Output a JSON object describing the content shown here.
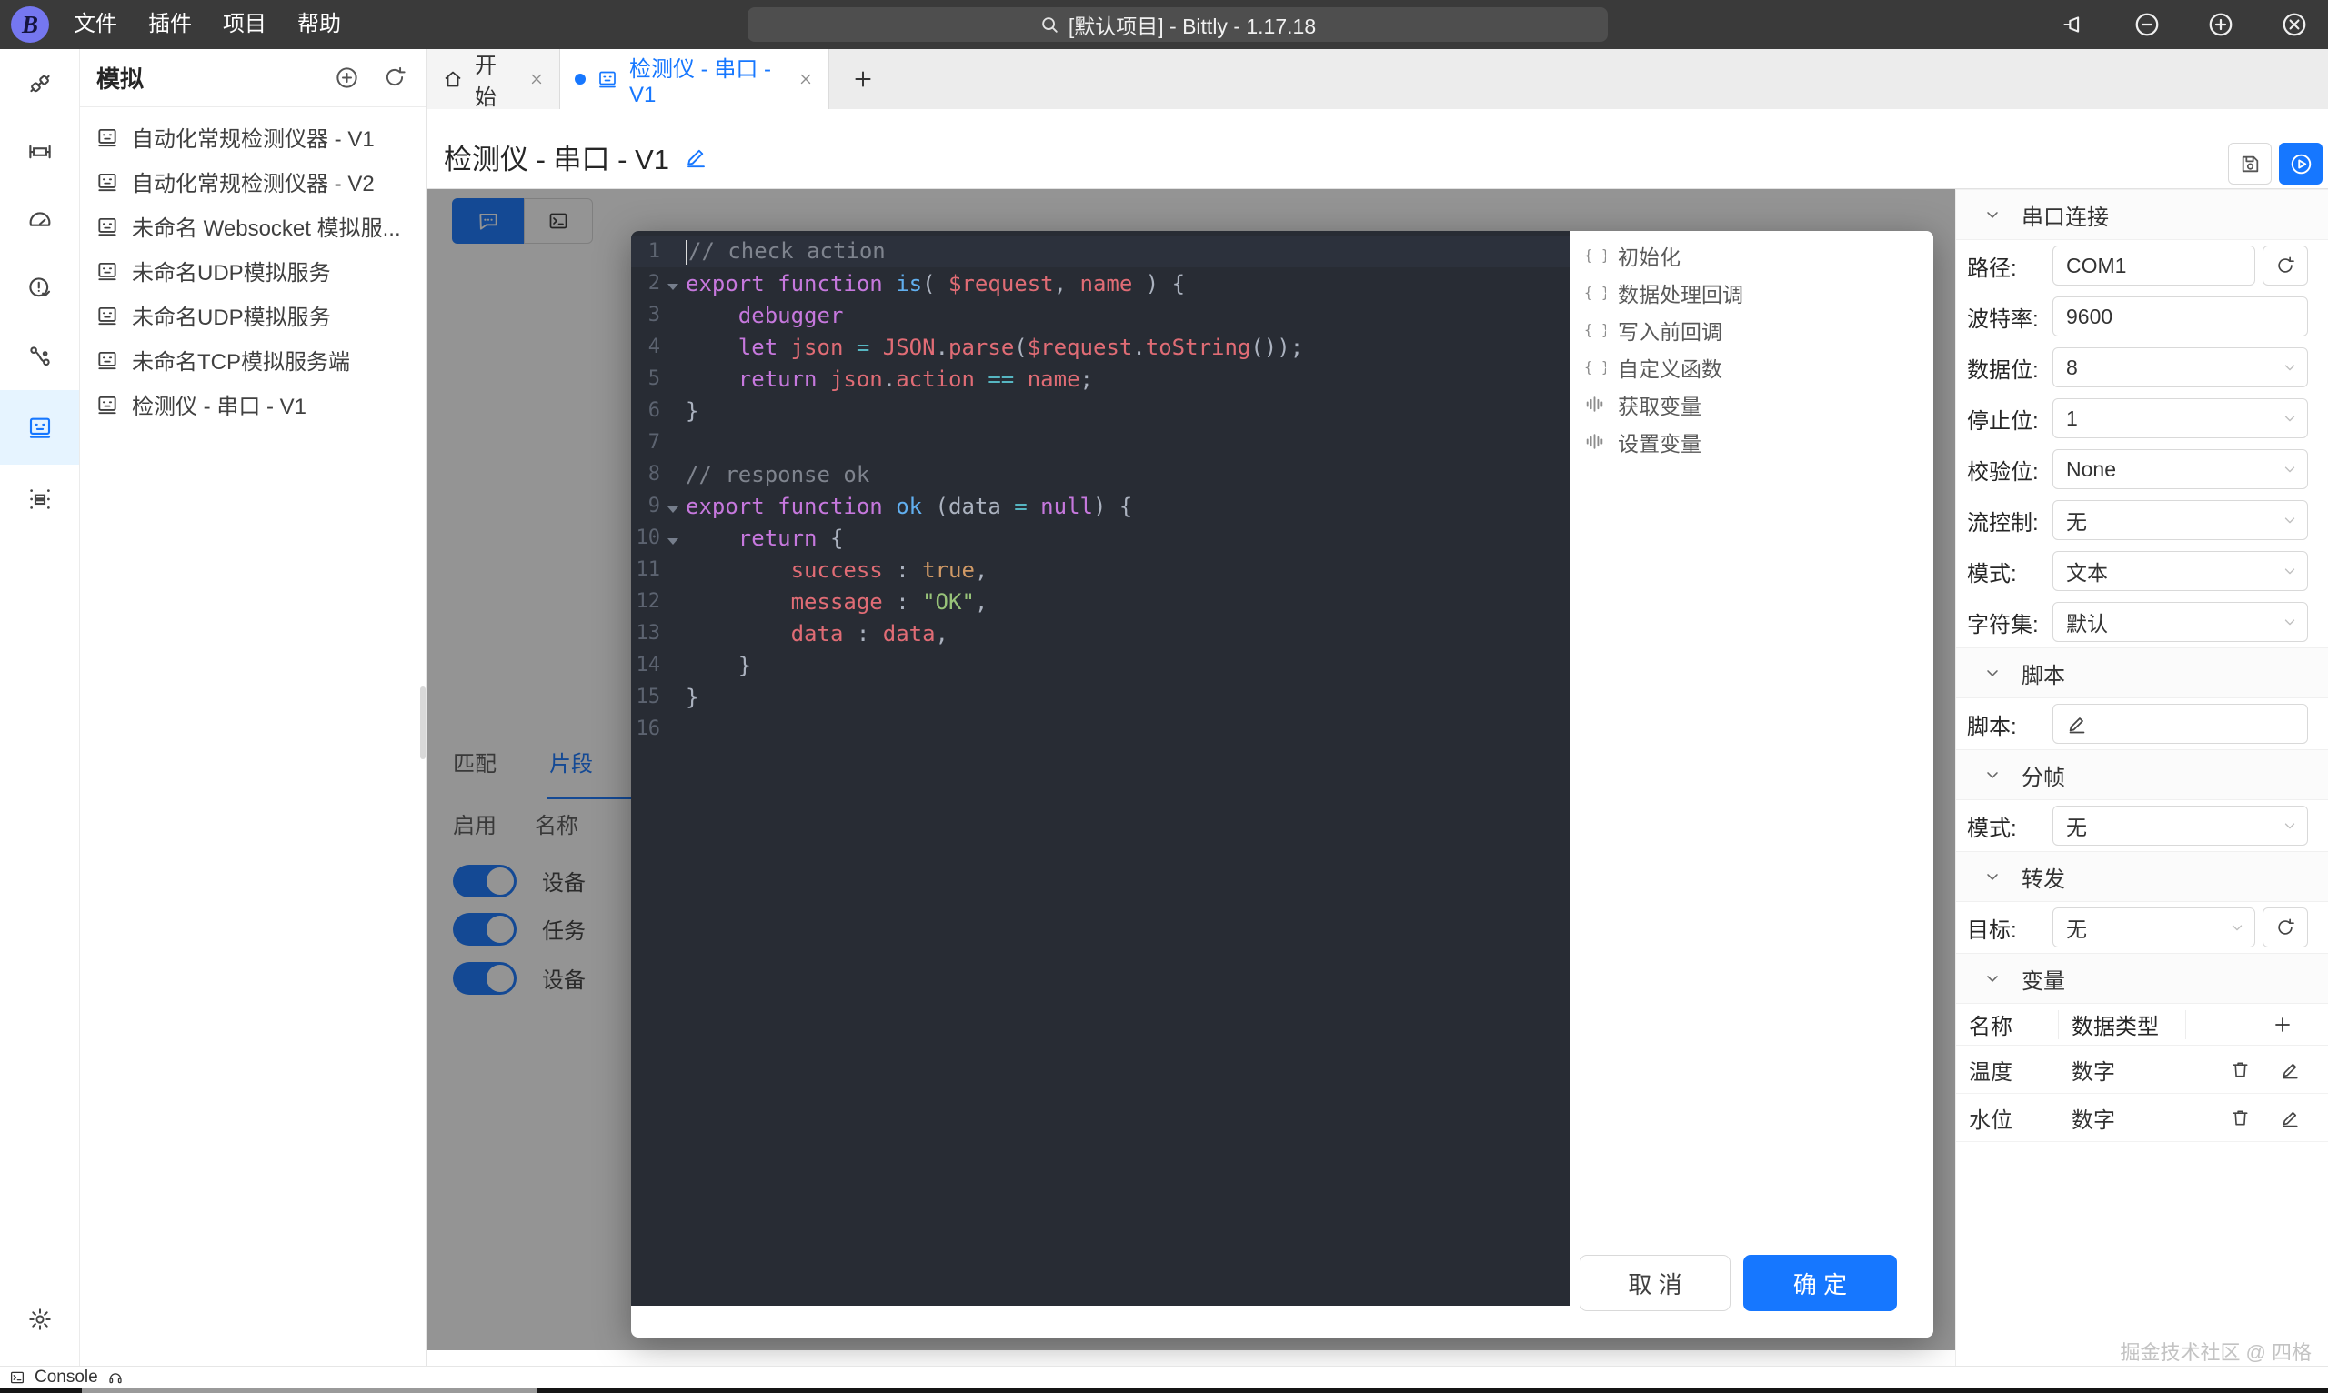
{
  "titlebar": {
    "logo_letter": "B",
    "menus": [
      {
        "label": "文件"
      },
      {
        "label": "插件"
      },
      {
        "label": "项目"
      },
      {
        "label": "帮助"
      }
    ],
    "search_text": "[默认项目] - Bittly - 1.17.18"
  },
  "sidebar": {
    "title": "模拟",
    "items": [
      {
        "label": "自动化常规检测仪器 - V1"
      },
      {
        "label": "自动化常规检测仪器 - V2"
      },
      {
        "label": "未命名 Websocket 模拟服..."
      },
      {
        "label": "未命名UDP模拟服务"
      },
      {
        "label": "未命名UDP模拟服务"
      },
      {
        "label": "未命名TCP模拟服务端"
      },
      {
        "label": "检测仪 - 串口 - V1"
      }
    ]
  },
  "tabs": {
    "start": "开始",
    "active": "检测仪 - 串口 - V1"
  },
  "page": {
    "title": "检测仪 - 串口 - V1"
  },
  "underlay": {
    "tab_match": "匹配",
    "tab_fragment": "片段",
    "col_enable": "启用",
    "col_name": "名称",
    "rows": [
      {
        "label": "设备"
      },
      {
        "label": "任务"
      },
      {
        "label": "设备"
      }
    ]
  },
  "editor": {
    "lines": [
      {
        "num": 1,
        "active": true,
        "cursor": true,
        "tokens": [
          [
            "com",
            "// check action"
          ]
        ]
      },
      {
        "num": 2,
        "fold": true,
        "tokens": [
          [
            "kw",
            "export"
          ],
          [
            "pl",
            " "
          ],
          [
            "kw",
            "function"
          ],
          [
            "pl",
            " "
          ],
          [
            "fn",
            "is"
          ],
          [
            "pl",
            "( "
          ],
          [
            "vr",
            "$request"
          ],
          [
            "pl",
            ", "
          ],
          [
            "vr",
            "name"
          ],
          [
            "pl",
            " ) {"
          ]
        ]
      },
      {
        "num": 3,
        "tokens": [
          [
            "pl",
            "    "
          ],
          [
            "kw",
            "debugger"
          ]
        ]
      },
      {
        "num": 4,
        "tokens": [
          [
            "pl",
            "    "
          ],
          [
            "kw",
            "let"
          ],
          [
            "pl",
            " "
          ],
          [
            "vr",
            "json"
          ],
          [
            "pl",
            " "
          ],
          [
            "op",
            "="
          ],
          [
            "pl",
            " "
          ],
          [
            "vr",
            "JSON"
          ],
          [
            "pl",
            "."
          ],
          [
            "vr",
            "parse"
          ],
          [
            "pl",
            "("
          ],
          [
            "vr",
            "$request"
          ],
          [
            "pl",
            "."
          ],
          [
            "vr",
            "toString"
          ],
          [
            "pl",
            "());"
          ]
        ]
      },
      {
        "num": 5,
        "tokens": [
          [
            "pl",
            "    "
          ],
          [
            "kw",
            "return"
          ],
          [
            "pl",
            " "
          ],
          [
            "vr",
            "json"
          ],
          [
            "pl",
            "."
          ],
          [
            "vr",
            "action"
          ],
          [
            "pl",
            " "
          ],
          [
            "op",
            "=="
          ],
          [
            "pl",
            " "
          ],
          [
            "vr",
            "name"
          ],
          [
            "pl",
            ";"
          ]
        ]
      },
      {
        "num": 6,
        "tokens": [
          [
            "pl",
            "}"
          ]
        ]
      },
      {
        "num": 7,
        "tokens": []
      },
      {
        "num": 8,
        "tokens": [
          [
            "com",
            "// response ok"
          ]
        ]
      },
      {
        "num": 9,
        "fold": true,
        "tokens": [
          [
            "kw",
            "export"
          ],
          [
            "pl",
            " "
          ],
          [
            "kw",
            "function"
          ],
          [
            "pl",
            " "
          ],
          [
            "fn",
            "ok"
          ],
          [
            "pl",
            " ("
          ],
          [
            "pl",
            "data"
          ],
          [
            "pl",
            " "
          ],
          [
            "op",
            "="
          ],
          [
            "pl",
            " "
          ],
          [
            "kw",
            "null"
          ],
          [
            "pl",
            ") {"
          ]
        ]
      },
      {
        "num": 10,
        "fold": true,
        "tokens": [
          [
            "pl",
            "    "
          ],
          [
            "kw",
            "return"
          ],
          [
            "pl",
            " {"
          ]
        ]
      },
      {
        "num": 11,
        "tokens": [
          [
            "pl",
            "        "
          ],
          [
            "vr",
            "success"
          ],
          [
            "pl",
            " : "
          ],
          [
            "num",
            "true"
          ],
          [
            "pl",
            ","
          ]
        ]
      },
      {
        "num": 12,
        "tokens": [
          [
            "pl",
            "        "
          ],
          [
            "vr",
            "message"
          ],
          [
            "pl",
            " : "
          ],
          [
            "str",
            "\"OK\""
          ],
          [
            "pl",
            ","
          ]
        ]
      },
      {
        "num": 13,
        "tokens": [
          [
            "pl",
            "        "
          ],
          [
            "vr",
            "data"
          ],
          [
            "pl",
            " : "
          ],
          [
            "vr",
            "data"
          ],
          [
            "pl",
            ","
          ]
        ]
      },
      {
        "num": 14,
        "tokens": [
          [
            "pl",
            "    }"
          ]
        ]
      },
      {
        "num": 15,
        "tokens": [
          [
            "pl",
            "}"
          ]
        ]
      },
      {
        "num": 16,
        "tokens": []
      }
    ]
  },
  "events": [
    {
      "icon": "braces-icon",
      "label": "初始化"
    },
    {
      "icon": "braces-icon",
      "label": "数据处理回调"
    },
    {
      "icon": "braces-icon",
      "label": "写入前回调"
    },
    {
      "icon": "braces-icon",
      "label": "自定义函数"
    },
    {
      "icon": "variable-icon",
      "label": "获取变量"
    },
    {
      "icon": "variable-icon",
      "label": "设置变量"
    }
  ],
  "dialog": {
    "cancel_label": "取 消",
    "ok_label": "确 定"
  },
  "panel": {
    "serial": {
      "title": "串口连接",
      "fields": [
        {
          "label": "路径:",
          "value": "COM1"
        },
        {
          "label": "波特率:",
          "value": "9600"
        },
        {
          "label": "数据位:",
          "value": "8"
        },
        {
          "label": "停止位:",
          "value": "1"
        },
        {
          "label": "校验位:",
          "value": "None"
        },
        {
          "label": "流控制:",
          "value": "无"
        },
        {
          "label": "模式:",
          "value": "文本"
        },
        {
          "label": "字符集:",
          "value": "默认"
        }
      ]
    },
    "script": {
      "title": "脚本",
      "label": "脚本:"
    },
    "framing": {
      "title": "分帧",
      "label": "模式:",
      "value": "无"
    },
    "forward": {
      "title": "转发",
      "label": "目标:",
      "value": "无"
    },
    "variables": {
      "title": "变量",
      "col_name": "名称",
      "col_type": "数据类型",
      "rows": [
        {
          "name": "温度",
          "type": "数字"
        },
        {
          "name": "水位",
          "type": "数字"
        }
      ]
    }
  },
  "statusbar": {
    "console_label": "Console"
  },
  "watermark": "掘金技术社区 @ 四格",
  "colors": {
    "accent": "#1677ff",
    "editor_bg": "#282c34",
    "titlebar_bg": "#3a3a3a"
  }
}
